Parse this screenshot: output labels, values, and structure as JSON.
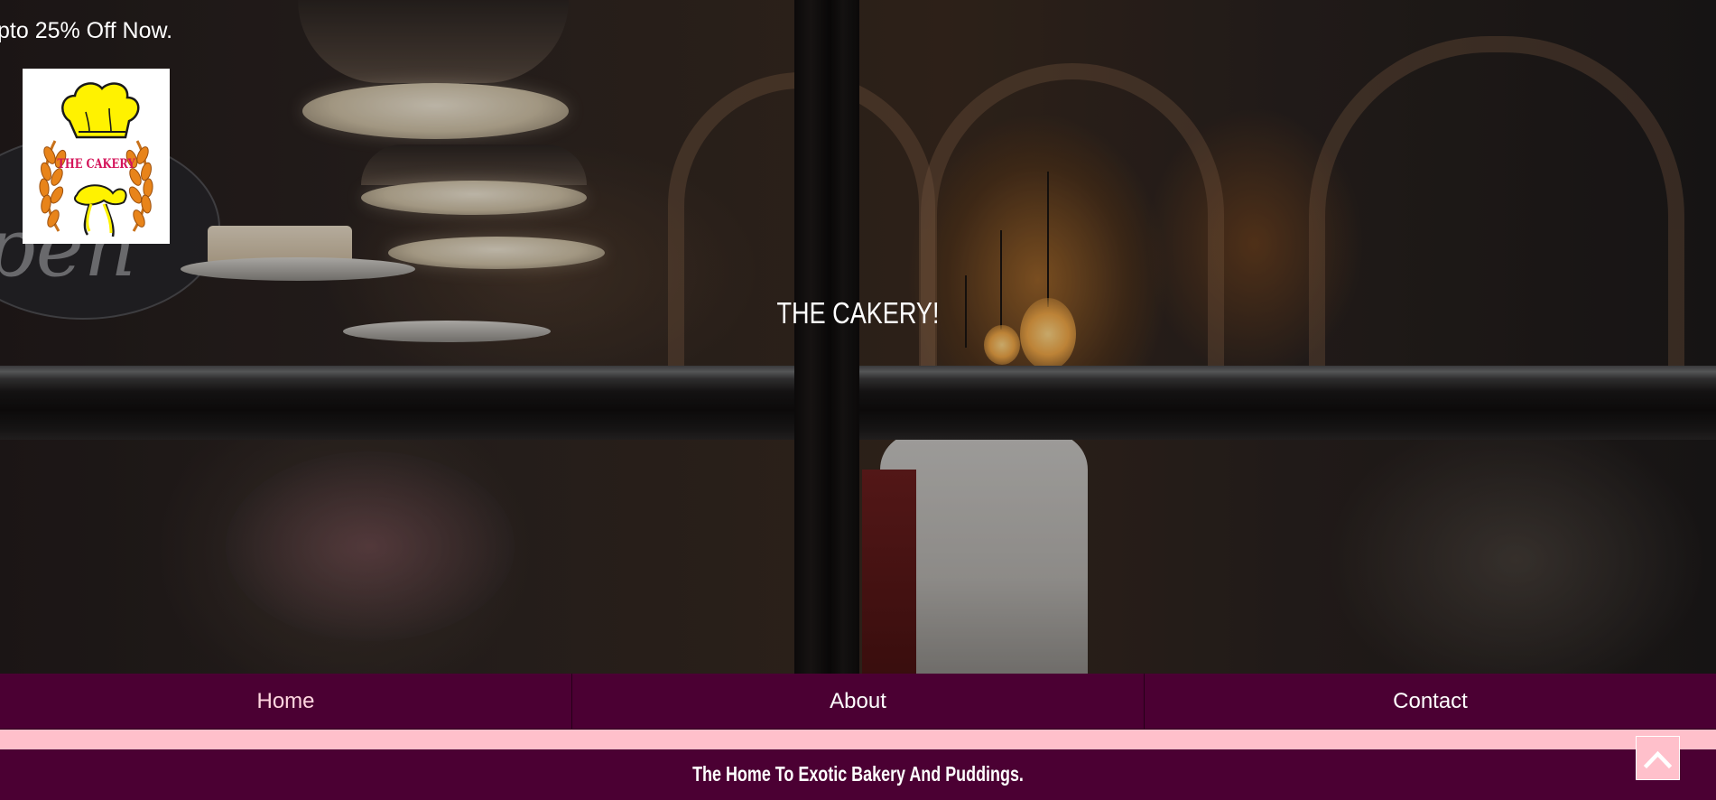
{
  "promo": {
    "text": "pto 25% Off Now."
  },
  "logo": {
    "text": "THE CAKERY",
    "icon": "chef-hat-wreath-logo"
  },
  "hero": {
    "title": "THE CAKERY!"
  },
  "nav": {
    "items": [
      {
        "label": "Home",
        "active": true
      },
      {
        "label": "About",
        "active": false
      },
      {
        "label": "Contact",
        "active": false
      }
    ]
  },
  "footer": {
    "tagline": "The Home To Exotic Bakery And Puddings."
  },
  "back_to_top": {
    "icon": "chevron-up-icon"
  },
  "colors": {
    "nav_bg": "#4b0033",
    "accent_pink": "#ffc0cb",
    "logo_yellow": "#fff200",
    "logo_magenta": "#d4145a",
    "logo_wheat": "#e8841a"
  }
}
